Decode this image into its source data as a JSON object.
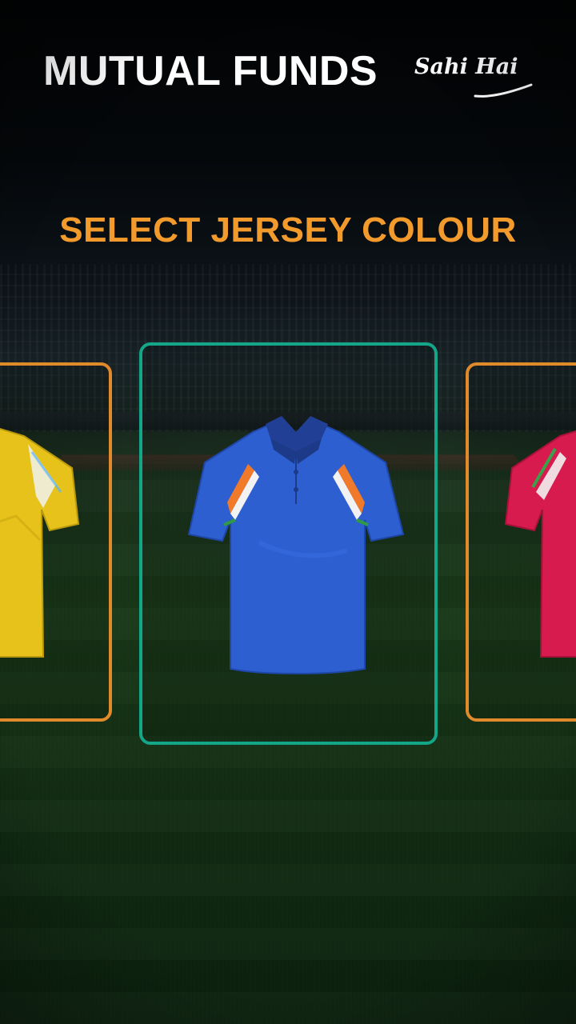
{
  "header": {
    "brand": "MUTUAL FUNDS",
    "tagline": "Sahi Hai"
  },
  "title": "SELECT JERSEY COLOUR",
  "jerseys": [
    {
      "color_name": "yellow",
      "shirt_color": "#e6c21a",
      "state": "unselected",
      "border_color": "#e08a2c"
    },
    {
      "color_name": "blue",
      "shirt_color": "#2d5fd0",
      "state": "selected",
      "border_color": "#14a688"
    },
    {
      "color_name": "pink",
      "shirt_color": "#d81b4e",
      "state": "unselected",
      "border_color": "#e08a2c"
    }
  ],
  "colors": {
    "title": "#f39a2c",
    "selected_border": "#14a688",
    "unselected_border": "#e08a2c"
  }
}
